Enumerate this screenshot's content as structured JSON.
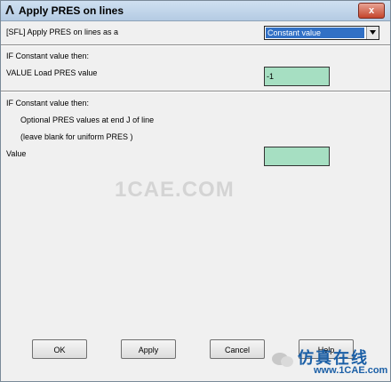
{
  "window": {
    "title": "Apply PRES on lines",
    "close_symbol": "x"
  },
  "row_apply": {
    "label": "[SFL] Apply PRES on lines as a",
    "selected": "Constant value"
  },
  "section1": {
    "heading": "IF Constant value then:",
    "field_label": "VALUE  Load PRES value",
    "field_value": "-1"
  },
  "section2": {
    "heading": "IF Constant value then:",
    "line1": "Optional PRES values at end J of line",
    "line2": "(leave blank for uniform PRES )",
    "field_label": "Value",
    "field_value": ""
  },
  "buttons": {
    "ok": "OK",
    "apply": "Apply",
    "cancel": "Cancel",
    "help": "Help"
  },
  "watermark": {
    "center": "1CAE.COM",
    "brand": "仿真在线",
    "brand_url": "www.1CAE.com"
  },
  "colors": {
    "field_bg": "#a6dfc2",
    "select_highlight": "#3170c5",
    "close_button": "#c4452c"
  },
  "icons": {
    "app": "ansys-logo-icon",
    "close": "close-icon",
    "dropdown": "chevron-down-icon"
  }
}
